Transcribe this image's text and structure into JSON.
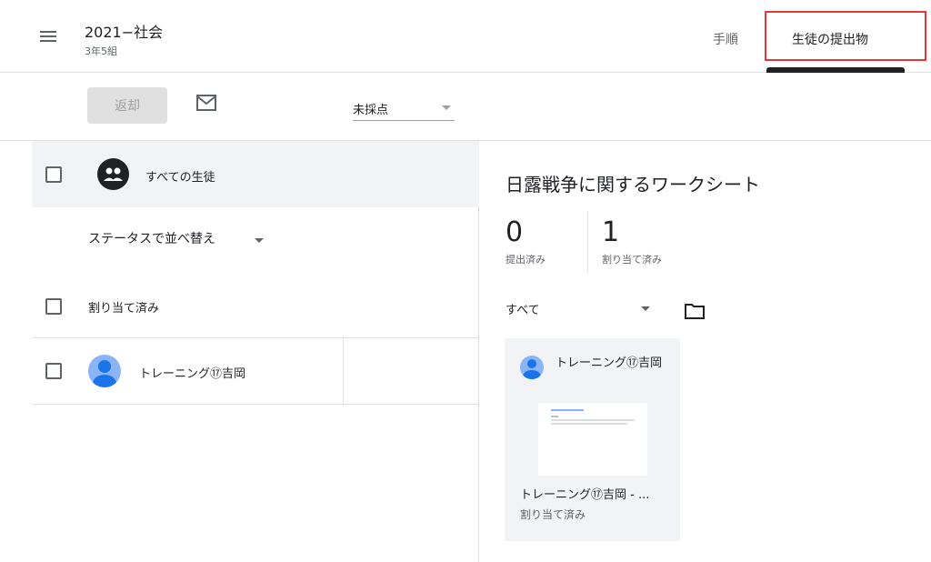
{
  "header": {
    "class_name": "2021−社会",
    "section": "3年5組",
    "tabs": [
      {
        "label": "手順"
      },
      {
        "label": "生徒の提出物"
      }
    ]
  },
  "toolbar": {
    "return_label": "返却",
    "filter_value": "未採点"
  },
  "left_panel": {
    "all_students_label": "すべての生徒",
    "sort_label": "ステータスで並べ替え",
    "group_label": "割り当て済み",
    "students": [
      {
        "name": "トレーニング⑰吉岡"
      }
    ]
  },
  "right_panel": {
    "assignment_title": "日露戦争に関するワークシート",
    "stats": [
      {
        "value": "0",
        "label": "提出済み"
      },
      {
        "value": "1",
        "label": "割り当て済み"
      }
    ],
    "filter_value": "すべて",
    "cards": [
      {
        "name": "トレーニング⑰吉岡",
        "file_name": "トレーニング⑰吉岡 - ...",
        "status": "割り当て済み"
      }
    ]
  },
  "colors": {
    "highlight": "#e53935",
    "avatar": "#8ab4f8",
    "selected_bg": "#f1f3f4"
  },
  "icons": [
    "menu-icon",
    "mail-icon",
    "group-icon",
    "folder-icon",
    "dropdown-arrow-icon",
    "avatar-icon"
  ]
}
